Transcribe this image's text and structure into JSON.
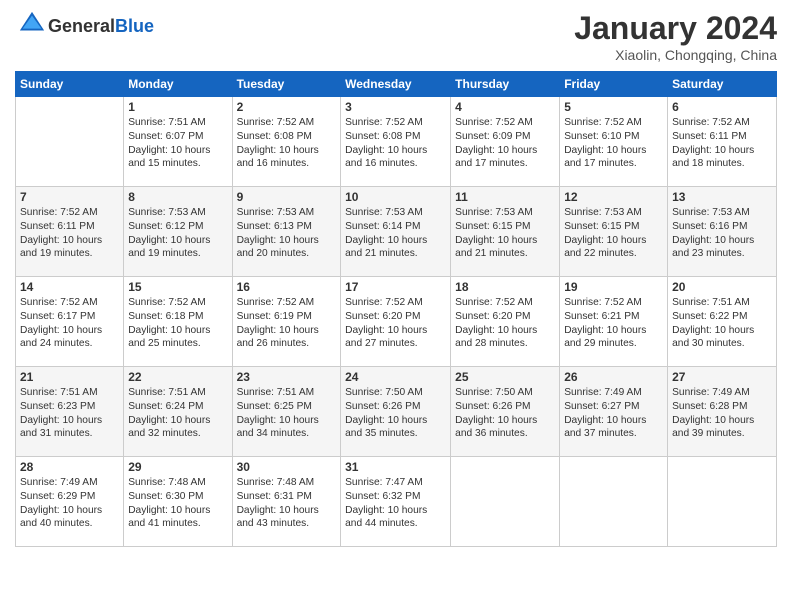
{
  "header": {
    "logo_general": "General",
    "logo_blue": "Blue",
    "month_title": "January 2024",
    "location": "Xiaolin, Chongqing, China"
  },
  "weekdays": [
    "Sunday",
    "Monday",
    "Tuesday",
    "Wednesday",
    "Thursday",
    "Friday",
    "Saturday"
  ],
  "weeks": [
    [
      {
        "day": "",
        "sunrise": "",
        "sunset": "",
        "daylight": ""
      },
      {
        "day": "1",
        "sunrise": "Sunrise: 7:51 AM",
        "sunset": "Sunset: 6:07 PM",
        "daylight": "Daylight: 10 hours and 15 minutes."
      },
      {
        "day": "2",
        "sunrise": "Sunrise: 7:52 AM",
        "sunset": "Sunset: 6:08 PM",
        "daylight": "Daylight: 10 hours and 16 minutes."
      },
      {
        "day": "3",
        "sunrise": "Sunrise: 7:52 AM",
        "sunset": "Sunset: 6:08 PM",
        "daylight": "Daylight: 10 hours and 16 minutes."
      },
      {
        "day": "4",
        "sunrise": "Sunrise: 7:52 AM",
        "sunset": "Sunset: 6:09 PM",
        "daylight": "Daylight: 10 hours and 17 minutes."
      },
      {
        "day": "5",
        "sunrise": "Sunrise: 7:52 AM",
        "sunset": "Sunset: 6:10 PM",
        "daylight": "Daylight: 10 hours and 17 minutes."
      },
      {
        "day": "6",
        "sunrise": "Sunrise: 7:52 AM",
        "sunset": "Sunset: 6:11 PM",
        "daylight": "Daylight: 10 hours and 18 minutes."
      }
    ],
    [
      {
        "day": "7",
        "sunrise": "Sunrise: 7:52 AM",
        "sunset": "Sunset: 6:11 PM",
        "daylight": "Daylight: 10 hours and 19 minutes."
      },
      {
        "day": "8",
        "sunrise": "Sunrise: 7:53 AM",
        "sunset": "Sunset: 6:12 PM",
        "daylight": "Daylight: 10 hours and 19 minutes."
      },
      {
        "day": "9",
        "sunrise": "Sunrise: 7:53 AM",
        "sunset": "Sunset: 6:13 PM",
        "daylight": "Daylight: 10 hours and 20 minutes."
      },
      {
        "day": "10",
        "sunrise": "Sunrise: 7:53 AM",
        "sunset": "Sunset: 6:14 PM",
        "daylight": "Daylight: 10 hours and 21 minutes."
      },
      {
        "day": "11",
        "sunrise": "Sunrise: 7:53 AM",
        "sunset": "Sunset: 6:15 PM",
        "daylight": "Daylight: 10 hours and 21 minutes."
      },
      {
        "day": "12",
        "sunrise": "Sunrise: 7:53 AM",
        "sunset": "Sunset: 6:15 PM",
        "daylight": "Daylight: 10 hours and 22 minutes."
      },
      {
        "day": "13",
        "sunrise": "Sunrise: 7:53 AM",
        "sunset": "Sunset: 6:16 PM",
        "daylight": "Daylight: 10 hours and 23 minutes."
      }
    ],
    [
      {
        "day": "14",
        "sunrise": "Sunrise: 7:52 AM",
        "sunset": "Sunset: 6:17 PM",
        "daylight": "Daylight: 10 hours and 24 minutes."
      },
      {
        "day": "15",
        "sunrise": "Sunrise: 7:52 AM",
        "sunset": "Sunset: 6:18 PM",
        "daylight": "Daylight: 10 hours and 25 minutes."
      },
      {
        "day": "16",
        "sunrise": "Sunrise: 7:52 AM",
        "sunset": "Sunset: 6:19 PM",
        "daylight": "Daylight: 10 hours and 26 minutes."
      },
      {
        "day": "17",
        "sunrise": "Sunrise: 7:52 AM",
        "sunset": "Sunset: 6:20 PM",
        "daylight": "Daylight: 10 hours and 27 minutes."
      },
      {
        "day": "18",
        "sunrise": "Sunrise: 7:52 AM",
        "sunset": "Sunset: 6:20 PM",
        "daylight": "Daylight: 10 hours and 28 minutes."
      },
      {
        "day": "19",
        "sunrise": "Sunrise: 7:52 AM",
        "sunset": "Sunset: 6:21 PM",
        "daylight": "Daylight: 10 hours and 29 minutes."
      },
      {
        "day": "20",
        "sunrise": "Sunrise: 7:51 AM",
        "sunset": "Sunset: 6:22 PM",
        "daylight": "Daylight: 10 hours and 30 minutes."
      }
    ],
    [
      {
        "day": "21",
        "sunrise": "Sunrise: 7:51 AM",
        "sunset": "Sunset: 6:23 PM",
        "daylight": "Daylight: 10 hours and 31 minutes."
      },
      {
        "day": "22",
        "sunrise": "Sunrise: 7:51 AM",
        "sunset": "Sunset: 6:24 PM",
        "daylight": "Daylight: 10 hours and 32 minutes."
      },
      {
        "day": "23",
        "sunrise": "Sunrise: 7:51 AM",
        "sunset": "Sunset: 6:25 PM",
        "daylight": "Daylight: 10 hours and 34 minutes."
      },
      {
        "day": "24",
        "sunrise": "Sunrise: 7:50 AM",
        "sunset": "Sunset: 6:26 PM",
        "daylight": "Daylight: 10 hours and 35 minutes."
      },
      {
        "day": "25",
        "sunrise": "Sunrise: 7:50 AM",
        "sunset": "Sunset: 6:26 PM",
        "daylight": "Daylight: 10 hours and 36 minutes."
      },
      {
        "day": "26",
        "sunrise": "Sunrise: 7:49 AM",
        "sunset": "Sunset: 6:27 PM",
        "daylight": "Daylight: 10 hours and 37 minutes."
      },
      {
        "day": "27",
        "sunrise": "Sunrise: 7:49 AM",
        "sunset": "Sunset: 6:28 PM",
        "daylight": "Daylight: 10 hours and 39 minutes."
      }
    ],
    [
      {
        "day": "28",
        "sunrise": "Sunrise: 7:49 AM",
        "sunset": "Sunset: 6:29 PM",
        "daylight": "Daylight: 10 hours and 40 minutes."
      },
      {
        "day": "29",
        "sunrise": "Sunrise: 7:48 AM",
        "sunset": "Sunset: 6:30 PM",
        "daylight": "Daylight: 10 hours and 41 minutes."
      },
      {
        "day": "30",
        "sunrise": "Sunrise: 7:48 AM",
        "sunset": "Sunset: 6:31 PM",
        "daylight": "Daylight: 10 hours and 43 minutes."
      },
      {
        "day": "31",
        "sunrise": "Sunrise: 7:47 AM",
        "sunset": "Sunset: 6:32 PM",
        "daylight": "Daylight: 10 hours and 44 minutes."
      },
      {
        "day": "",
        "sunrise": "",
        "sunset": "",
        "daylight": ""
      },
      {
        "day": "",
        "sunrise": "",
        "sunset": "",
        "daylight": ""
      },
      {
        "day": "",
        "sunrise": "",
        "sunset": "",
        "daylight": ""
      }
    ]
  ]
}
